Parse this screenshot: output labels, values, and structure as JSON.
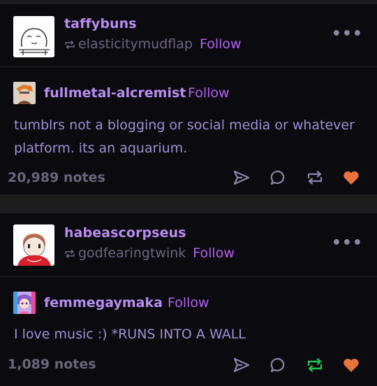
{
  "posts": [
    {
      "blog": "taffybuns",
      "reblogged_from": "elasticitymudflap",
      "follow_label": "Follow",
      "menu": "•••",
      "trail": [
        {
          "author": "fullmetal-alcremist",
          "follow_label": "Follow",
          "text": "tumblrs not a blogging or social media or whatever platform. its an aquarium."
        }
      ],
      "notes": "20,989 notes",
      "reblogged": false,
      "liked": true
    },
    {
      "blog": "habeascorpseus",
      "reblogged_from": "godfearingtwink",
      "follow_label": "Follow",
      "menu": "•••",
      "trail": [
        {
          "author": "femmegaymaka",
          "follow_label": "Follow",
          "text": "I love music :) *RUNS INTO A WALL"
        }
      ],
      "notes": "1,089 notes",
      "reblogged": true,
      "liked": true
    }
  ],
  "icons": {
    "share": "paper-plane-icon",
    "reply": "speech-bubble-icon",
    "reblog": "reblog-arrows-icon",
    "like": "heart-icon"
  },
  "colors": {
    "background": "#0b0a0e",
    "accent": "#b361f5",
    "blog_name": "#b88df2",
    "text": "#a190d6",
    "muted": "#6d6680",
    "liked": "#e8743b",
    "reblogged": "#20c454"
  }
}
